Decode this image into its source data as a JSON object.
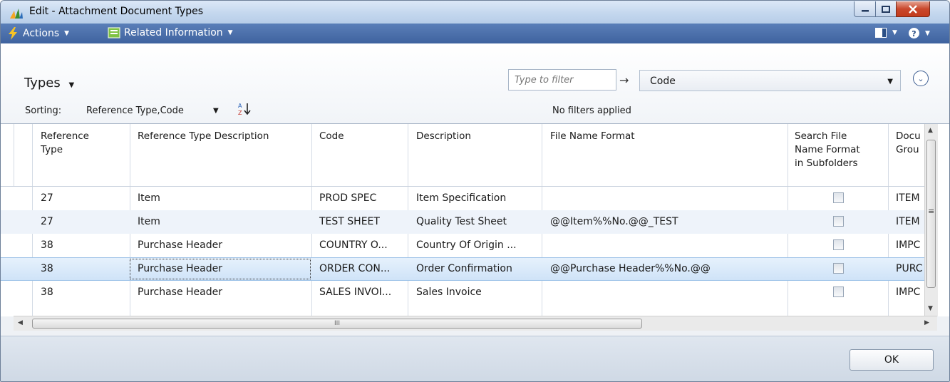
{
  "window": {
    "title": "Edit - Attachment Document Types"
  },
  "actionbar": {
    "actions_label": "Actions",
    "related_label": "Related Information"
  },
  "header": {
    "title": "Types",
    "filter_placeholder": "Type to filter",
    "filter_field": "Code",
    "sorting_label": "Sorting:",
    "sorting_value": "Reference Type,Code",
    "filters_status": "No filters applied"
  },
  "table": {
    "columns": [
      [
        "Reference",
        "Type"
      ],
      [
        "Reference Type Description"
      ],
      [
        "Code"
      ],
      [
        "Description"
      ],
      [
        "File Name Format"
      ],
      [
        "Search File",
        "Name Format",
        "in Subfolders"
      ],
      [
        "Docu",
        "Grou"
      ]
    ],
    "rows": [
      {
        "ref_type": "27",
        "ref_desc": "Item",
        "code": "PROD SPEC",
        "description": "Item Specification",
        "file_format": "",
        "search_sub": false,
        "doc_group": "ITEM"
      },
      {
        "ref_type": "27",
        "ref_desc": "Item",
        "code": "TEST SHEET",
        "description": "Quality Test Sheet",
        "file_format": "@@Item%%No.@@_TEST",
        "search_sub": false,
        "doc_group": "ITEM"
      },
      {
        "ref_type": "38",
        "ref_desc": "Purchase Header",
        "code": "COUNTRY O...",
        "description": "Country Of Origin ...",
        "file_format": "",
        "search_sub": false,
        "doc_group": "IMPC"
      },
      {
        "ref_type": "38",
        "ref_desc": "Purchase Header",
        "code": "ORDER CON...",
        "description": "Order Confirmation",
        "file_format": "@@Purchase Header%%No.@@",
        "search_sub": false,
        "doc_group": "PURC"
      },
      {
        "ref_type": "38",
        "ref_desc": "Purchase Header",
        "code": "SALES INVOI...",
        "description": "Sales Invoice",
        "file_format": "",
        "search_sub": false,
        "doc_group": "IMPC"
      }
    ],
    "selected_row": 3,
    "scroll_mark": "III"
  },
  "footer": {
    "ok_label": "OK"
  },
  "colors": {
    "actionbar": "#4a6fa8",
    "close_button": "#c23b1d",
    "selected_row": "#d4e7fa"
  }
}
